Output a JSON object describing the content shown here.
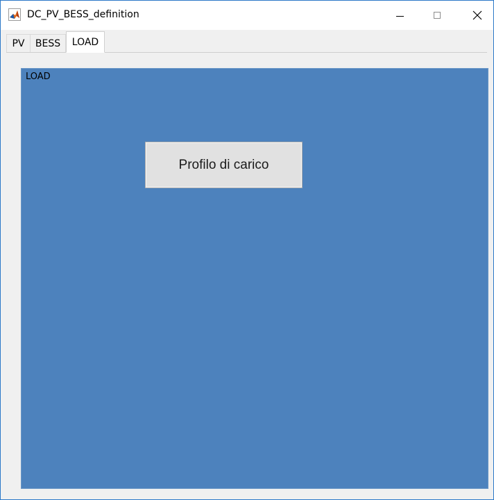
{
  "window": {
    "title": "DC_PV_BESS_definition",
    "icon": "matlab-icon"
  },
  "tabs": [
    {
      "label": "PV",
      "selected": false
    },
    {
      "label": "BESS",
      "selected": false
    },
    {
      "label": "LOAD",
      "selected": true
    }
  ],
  "panel": {
    "title": "LOAD",
    "background_color": "#4d82bd"
  },
  "buttons": {
    "profile_label": "Profilo di carico"
  },
  "colors": {
    "window_border": "#2b78c8",
    "panel": "#4d82bd",
    "button": "#e1e1e1"
  }
}
